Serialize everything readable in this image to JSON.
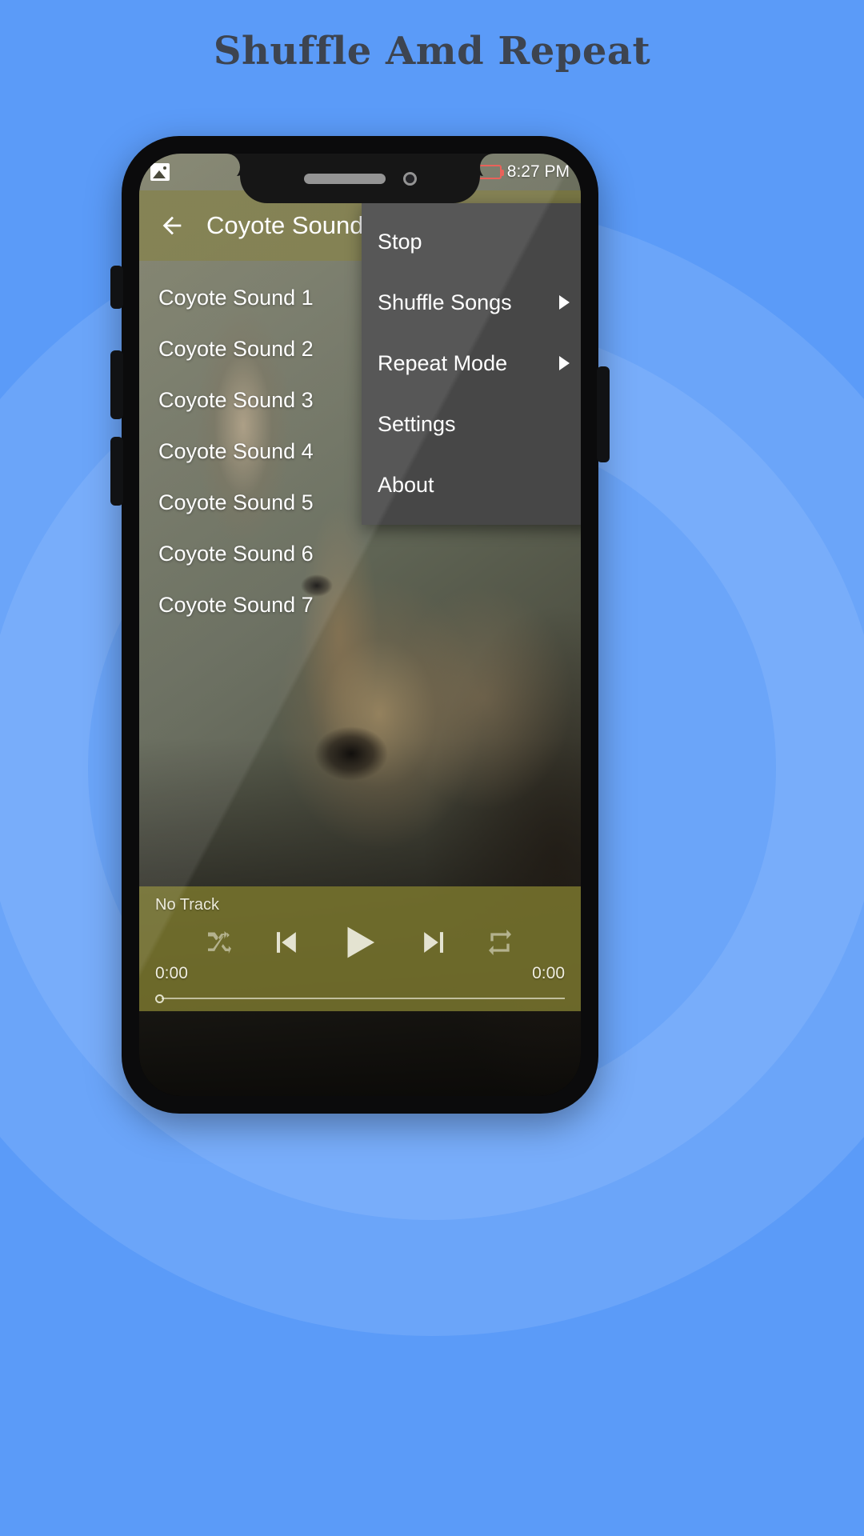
{
  "page": {
    "heading": "Shuffle Amd Repeat",
    "background_color": "#5b9bf8",
    "heading_color": "#3d4450"
  },
  "phone": {
    "status_bar": {
      "left_icon": "photo-icon",
      "battery_percent": "8%",
      "time": "8:27 PM",
      "battery_color": "#e8534a"
    }
  },
  "appbar": {
    "back_icon": "back-arrow-icon",
    "title": "Coyote Sounds",
    "background_color": "#7a763e"
  },
  "songlist": {
    "items": [
      {
        "label": "Coyote Sound 1"
      },
      {
        "label": "Coyote Sound 2"
      },
      {
        "label": "Coyote Sound 3"
      },
      {
        "label": "Coyote Sound 4"
      },
      {
        "label": "Coyote Sound 5"
      },
      {
        "label": "Coyote Sound 6"
      },
      {
        "label": "Coyote Sound 7"
      }
    ]
  },
  "overflow_menu": {
    "background_color": "#474747",
    "items": [
      {
        "label": "Stop",
        "has_submenu": false
      },
      {
        "label": "Shuffle Songs",
        "has_submenu": true
      },
      {
        "label": "Repeat Mode",
        "has_submenu": true
      },
      {
        "label": "Settings",
        "has_submenu": false
      },
      {
        "label": "About",
        "has_submenu": false
      }
    ]
  },
  "player": {
    "track_title": "No Track",
    "elapsed_time": "0:00",
    "total_time": "0:00",
    "progress_percent": 0,
    "controls": [
      {
        "name": "shuffle-icon"
      },
      {
        "name": "previous-icon"
      },
      {
        "name": "play-icon"
      },
      {
        "name": "next-icon"
      },
      {
        "name": "repeat-icon"
      }
    ]
  }
}
